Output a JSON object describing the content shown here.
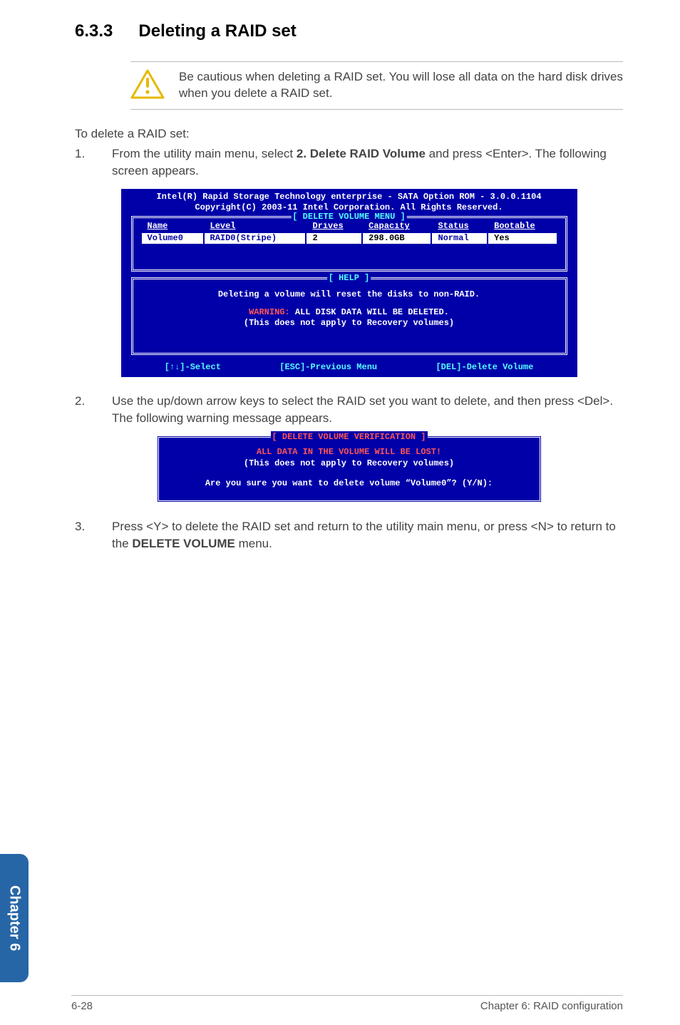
{
  "heading": {
    "number": "6.3.3",
    "title": "Deleting a RAID set"
  },
  "warning": "Be cautious when deleting a RAID set. You will lose all data on the hard disk drives when you delete a RAID set.",
  "intro": "To delete a RAID set:",
  "steps": {
    "s1": {
      "num": "1.",
      "pre": "From the utility main menu, select ",
      "bold": "2. Delete RAID Volume",
      "post": " and press <Enter>. The following screen appears."
    },
    "s2": {
      "num": "2.",
      "text": "Use the up/down arrow keys to select the RAID set you want to delete, and then press <Del>. The following warning message appears."
    },
    "s3": {
      "num": "3.",
      "pre": "Press <Y> to delete the RAID set and return to the utility main menu, or press <N> to return to the ",
      "bold": "DELETE VOLUME",
      "post": " menu."
    }
  },
  "bios_main": {
    "header1": "Intel(R) Rapid Storage Technology enterprise - SATA Option ROM - 3.0.0.1104",
    "header2": "Copyright(C) 2003-11 Intel Corporation.  All Rights Reserved.",
    "menu_title": "[ DELETE VOLUME MENU ]",
    "columns": {
      "c1": "Name",
      "c2": "Level",
      "c3": "Drives",
      "c4": "Capacity",
      "c5": "Status",
      "c6": "Bootable"
    },
    "row": {
      "c1": "Volume0",
      "c2": "RAID0(Stripe)",
      "c3": "2",
      "c4": "298.0GB",
      "c5": "Normal",
      "c6": "Yes"
    },
    "help_title": "[ HELP ]",
    "help_line1": "Deleting a volume will reset the disks to non-RAID.",
    "help_warn_prefix": "WARNING:",
    "help_warn_rest": " ALL DISK DATA WILL BE DELETED.",
    "help_line3": "(This does not apply to Recovery volumes)",
    "footer": {
      "f1": "[↑↓]-Select",
      "f2": "[ESC]-Previous Menu",
      "f3": "[DEL]-Delete Volume"
    }
  },
  "bios_confirm": {
    "title": "[ DELETE VOLUME VERIFICATION ]",
    "line1": "ALL DATA IN THE VOLUME WILL BE LOST!",
    "line2": "(This does not apply to Recovery volumes)",
    "line3": "Are you sure you want to delete volume “Volume0”? (Y/N):"
  },
  "chapter_tab": "Chapter 6",
  "footer": {
    "left": "6-28",
    "right": "Chapter 6: RAID configuration"
  }
}
